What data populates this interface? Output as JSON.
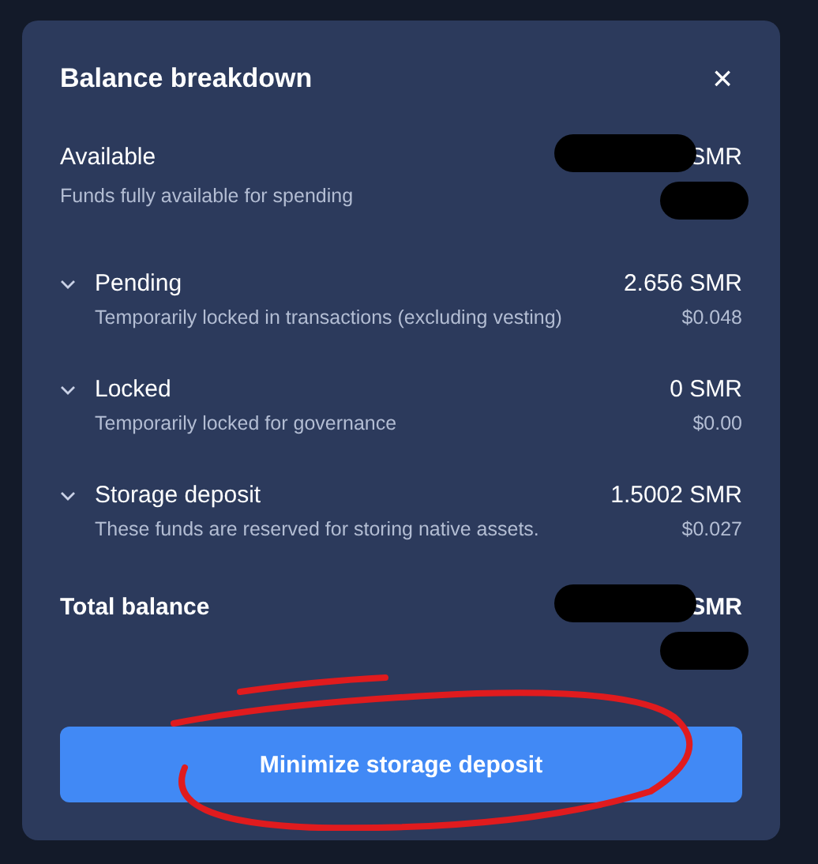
{
  "dialog": {
    "title": "Balance breakdown",
    "close_icon": "×"
  },
  "rows": [
    {
      "kind": "plain",
      "label": "Available",
      "amount": "SMR",
      "redacted": true,
      "description": "Funds fully available for spending"
    },
    {
      "kind": "expandable",
      "label": "Pending",
      "amount": "2.656 SMR",
      "fiat": "$0.048",
      "description": "Temporarily locked in transactions (excluding vesting)"
    },
    {
      "kind": "expandable",
      "label": "Locked",
      "amount": "0 SMR",
      "fiat": "$0.00",
      "description": "Temporarily locked for governance"
    },
    {
      "kind": "expandable",
      "label": "Storage deposit",
      "amount": "1.5002 SMR",
      "fiat": "$0.027",
      "description": "These funds are reserved for storing native assets."
    }
  ],
  "total": {
    "label": "Total balance",
    "amount": "SMR",
    "redacted": true
  },
  "button": "Minimize storage deposit"
}
